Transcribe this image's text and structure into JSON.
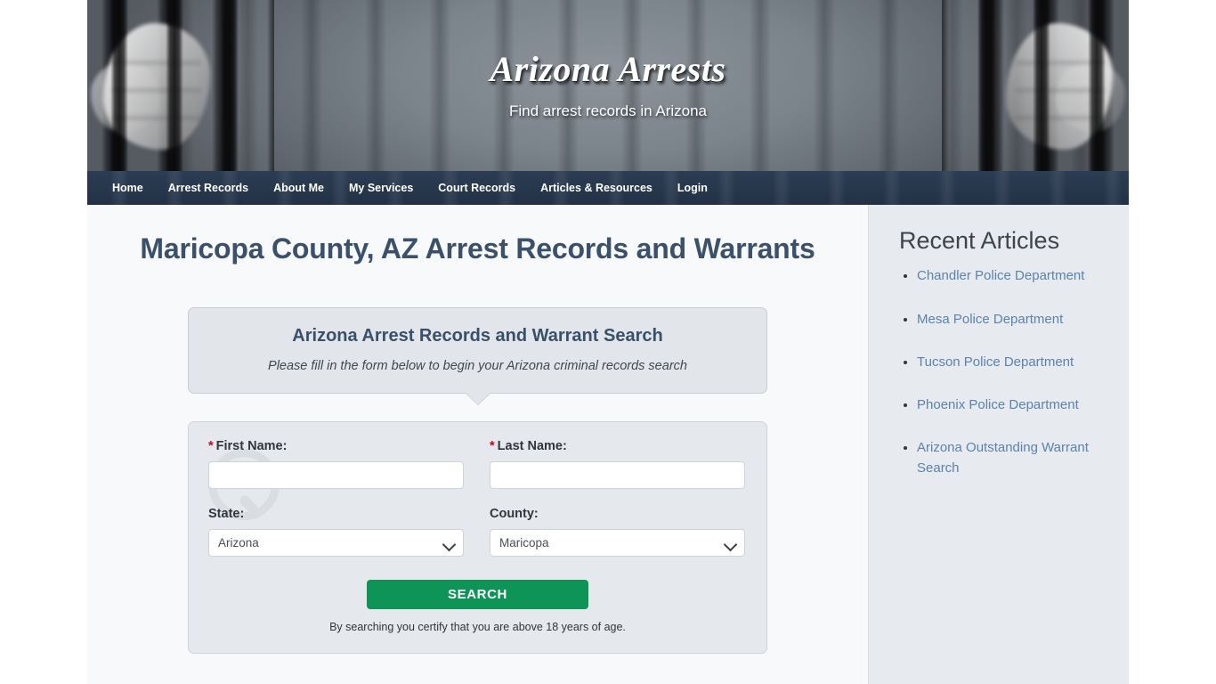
{
  "masthead": {
    "title": "Arizona Arrests",
    "tagline": "Find arrest records in Arizona",
    "photo_alt": "hands-on-jail-bars-photo"
  },
  "nav": {
    "items": [
      {
        "label": "Home"
      },
      {
        "label": "Arrest Records"
      },
      {
        "label": "About Me"
      },
      {
        "label": "My Services"
      },
      {
        "label": "Court Records"
      },
      {
        "label": "Articles & Resources"
      },
      {
        "label": "Login"
      }
    ]
  },
  "main": {
    "page_title": "Maricopa County, AZ Arrest Records and Warrants",
    "intro": {
      "title": "Arizona Arrest Records and Warrant Search",
      "subtitle": "Please fill in the form below to begin your Arizona criminal records search"
    },
    "form": {
      "first_name": {
        "label": "First Name:",
        "required_marker": "*",
        "value": "",
        "placeholder": ""
      },
      "last_name": {
        "label": "Last Name:",
        "required_marker": "*",
        "value": "",
        "placeholder": ""
      },
      "state": {
        "label": "State:",
        "selected": "Arizona"
      },
      "county": {
        "label": "County:",
        "selected": "Maricopa"
      },
      "search_button": "SEARCH",
      "disclaimer": "By searching you certify that you are above 18 years of age."
    }
  },
  "sidebar": {
    "title": "Recent Articles",
    "articles": [
      {
        "label": "Chandler Police Department"
      },
      {
        "label": "Mesa Police Department"
      },
      {
        "label": "Tucson Police Department"
      },
      {
        "label": "Phoenix Police Department"
      },
      {
        "label": "Arizona Outstanding Warrant Search"
      }
    ]
  },
  "colors": {
    "nav_bar": "#27374c",
    "heading": "#3a506b",
    "search_button": "#0e9457",
    "link": "#5b83ae",
    "sidebar_bg": "#e7eaef",
    "panel_bg": "#e2e6eb",
    "content_bg": "#f7f9fa",
    "required_marker": "#d0021b"
  }
}
